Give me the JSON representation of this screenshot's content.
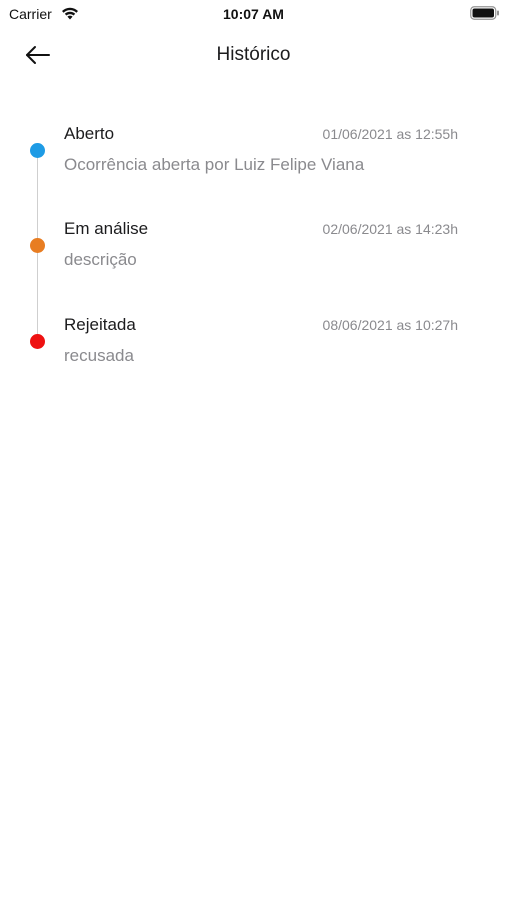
{
  "status_bar": {
    "carrier": "Carrier",
    "time": "10:07 AM",
    "icons": [
      "wifi-icon",
      "battery-icon"
    ]
  },
  "header": {
    "back_icon": "arrow-left-icon",
    "title": "Histórico"
  },
  "timeline": {
    "line_color": "#cfcfcf",
    "events": [
      {
        "status": "Aberto",
        "datetime": "01/06/2021 as 12:55h",
        "description": "Ocorrência aberta por Luiz Felipe Viana",
        "color": "#1e9be5"
      },
      {
        "status": "Em análise",
        "datetime": "02/06/2021 as 14:23h",
        "description": "descrição",
        "color": "#e87d22"
      },
      {
        "status": "Rejeitada",
        "datetime": "08/06/2021 as 10:27h",
        "description": "recusada",
        "color": "#ee1111"
      }
    ]
  }
}
